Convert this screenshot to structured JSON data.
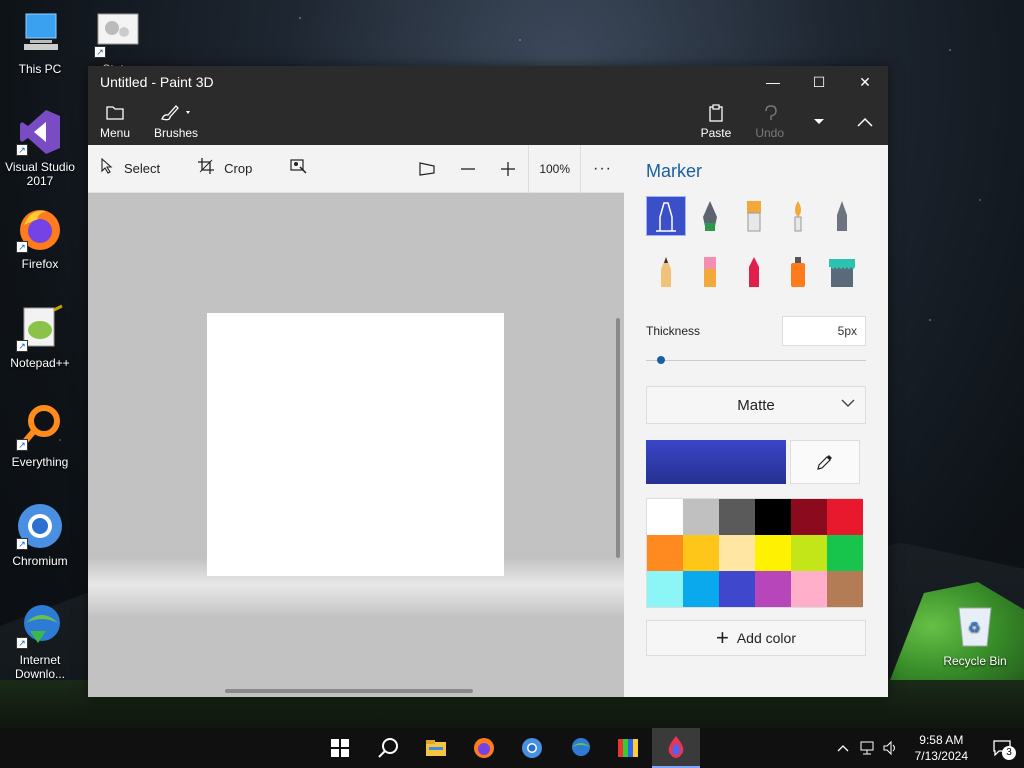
{
  "desktop": {
    "icons": [
      {
        "label": "This PC",
        "icon": "computer-icon"
      },
      {
        "label": "Stat...",
        "icon": "settings-shortcut-icon"
      },
      {
        "label": "Visual Studio 2017",
        "icon": "visual-studio-icon"
      },
      {
        "label": "Firefox",
        "icon": "firefox-icon"
      },
      {
        "label": "Notepad++",
        "icon": "notepad-plus-plus-icon"
      },
      {
        "label": "Everything",
        "icon": "everything-search-icon"
      },
      {
        "label": "Chromium",
        "icon": "chromium-icon"
      },
      {
        "label": "Internet Downlo...",
        "icon": "internet-download-manager-icon"
      },
      {
        "label": "Recycle Bin",
        "icon": "recycle-bin-icon"
      }
    ]
  },
  "window": {
    "title": "Untitled - Paint 3D",
    "controls": {
      "minimize": "—",
      "maximize": "☐",
      "close": "✕"
    }
  },
  "ribbon": {
    "menu": "Menu",
    "brushes": "Brushes",
    "paste": "Paste",
    "undo": "Undo"
  },
  "toolbar": {
    "select": "Select",
    "crop": "Crop",
    "zoom": "100%",
    "more": "···"
  },
  "panel": {
    "title": "Marker",
    "thickness_label": "Thickness",
    "thickness_value": "5px",
    "thickness_fraction": 0.05,
    "finish": "Matte",
    "add_color": "Add color",
    "tools": [
      "marker-icon",
      "calligraphy-pen-icon",
      "oil-brush-icon",
      "watercolor-icon",
      "pixel-pen-icon",
      "pencil-icon",
      "eraser-icon",
      "crayon-icon",
      "spray-can-icon",
      "fill-bucket-icon"
    ],
    "current_color": "#3a46c8",
    "palette": [
      "#ffffff",
      "#c0c0c0",
      "#5a5a5a",
      "#000000",
      "#8b0a1e",
      "#e8192c",
      "#ff8a1f",
      "#ffc61a",
      "#ffe6a3",
      "#fff200",
      "#c2e617",
      "#17c44c",
      "#8cf5f5",
      "#0aa8ec",
      "#3f48cc",
      "#b646b9",
      "#ffafc9",
      "#b47c55"
    ]
  },
  "taskbar": {
    "time": "9:58 AM",
    "date": "7/13/2024",
    "notifications": "3"
  }
}
